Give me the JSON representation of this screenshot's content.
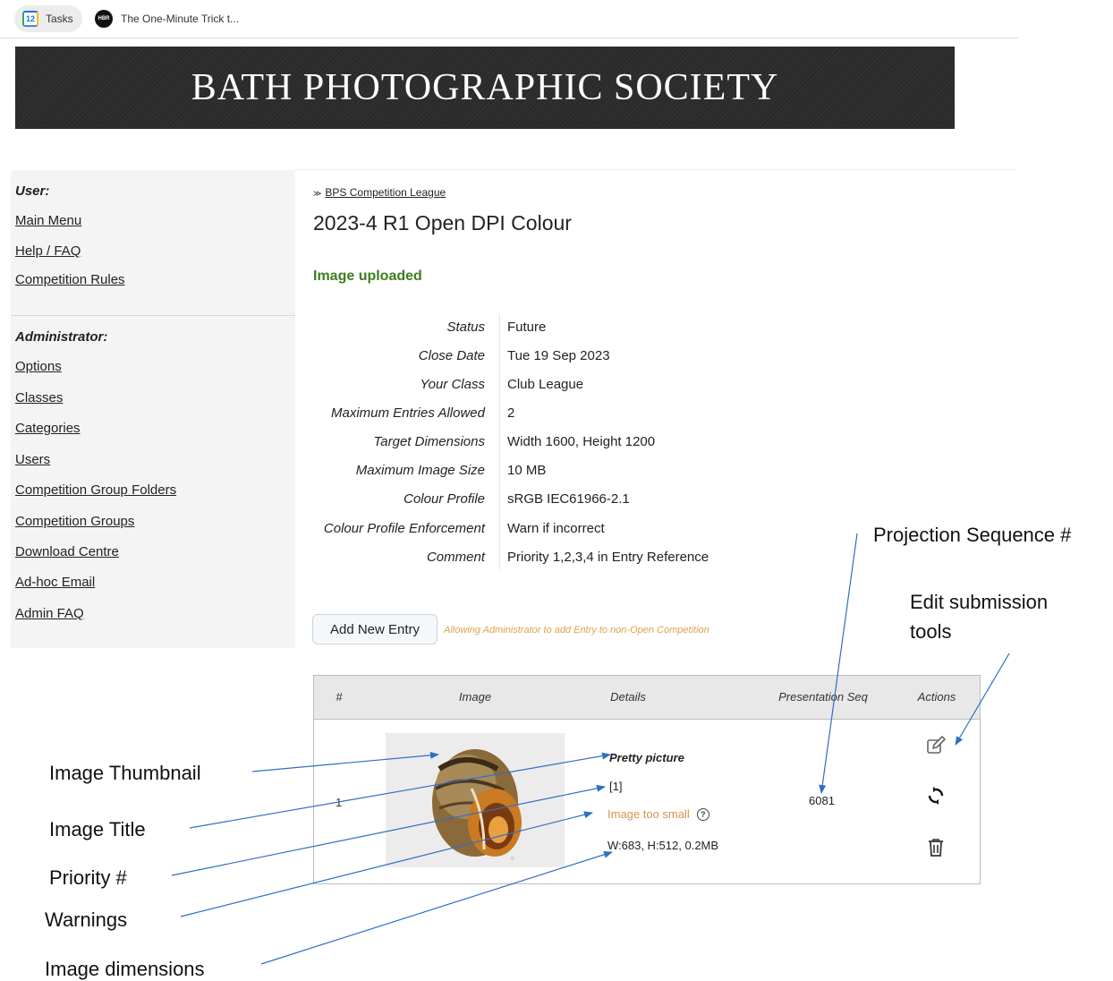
{
  "bookmarks": [
    {
      "label": "Tasks",
      "icon": "calendar-icon",
      "icon_text": "12"
    },
    {
      "label": "The One-Minute Trick t...",
      "icon": "hbr-icon",
      "icon_text": "HBR"
    }
  ],
  "banner": {
    "title": "BATH PHOTOGRAPHIC SOCIETY"
  },
  "sidebar": {
    "user_heading": "User:",
    "user_links": [
      "Main Menu",
      "Help / FAQ",
      "Competition Rules"
    ],
    "admin_heading": "Administrator:",
    "admin_links": [
      "Options",
      "Classes",
      "Categories",
      "Users",
      "Competition Group Folders",
      "Competition Groups",
      "Download Centre",
      "Ad-hoc Email",
      "Admin FAQ"
    ]
  },
  "breadcrumb": {
    "arrows": "≫",
    "link": "BPS Competition League"
  },
  "page_title": "2023-4 R1 Open DPI Colour",
  "status_message": "Image uploaded",
  "info": [
    {
      "label": "Status",
      "value": "Future"
    },
    {
      "label": "Close Date",
      "value": "Tue 19 Sep 2023"
    },
    {
      "label": "Your Class",
      "value": "Club League"
    },
    {
      "label": "Maximum Entries Allowed",
      "value": "2"
    },
    {
      "label": "Target Dimensions",
      "value": "Width 1600, Height 1200"
    },
    {
      "label": "Maximum Image Size",
      "value": "10 MB"
    },
    {
      "label": "Colour Profile",
      "value": "sRGB IEC61966-2.1"
    },
    {
      "label": "Colour Profile Enforcement",
      "value": "Warn if incorrect"
    },
    {
      "label": "Comment",
      "value": "Priority 1,2,3,4 in Entry Reference"
    }
  ],
  "add_entry": {
    "label": "Add New Entry",
    "note": "Allowing Administrator to add Entry to non-Open Competition"
  },
  "table": {
    "headers": [
      "#",
      "Image",
      "Details",
      "Presentation Seq",
      "Actions"
    ],
    "rows": [
      {
        "num": "1",
        "title": "Pretty picture",
        "priority": "[1]",
        "warning": "Image too small",
        "dimensions": "W:683, H:512, 0.2MB",
        "seq": "6081"
      }
    ]
  },
  "annotations": {
    "projection_seq": "Projection Sequence #",
    "edit_tools_line1": "Edit submission",
    "edit_tools_line2": "tools",
    "image_thumbnail": "Image Thumbnail",
    "image_title": "Image Title",
    "priority": "Priority #",
    "warnings": "Warnings",
    "image_dimensions": "Image dimensions"
  },
  "colors": {
    "accent_green": "#3d7d1f",
    "warning_orange": "#d9924a",
    "arrow_blue": "#2f6fc4"
  }
}
